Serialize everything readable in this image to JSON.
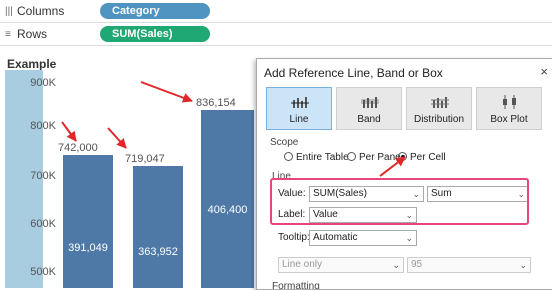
{
  "shelves": {
    "columns": {
      "label": "Columns",
      "pill": "Category"
    },
    "rows": {
      "label": "Rows",
      "pill": "SUM(Sales)"
    }
  },
  "view": {
    "title": "Example",
    "y_ticks": [
      "900K",
      "800K",
      "700K",
      "600K",
      "500K"
    ],
    "bars": [
      {
        "inner": "",
        "label": ""
      },
      {
        "inner": "391,049",
        "label": "742,000"
      },
      {
        "inner": "363,952",
        "label": "719,047"
      },
      {
        "inner": "406,400",
        "label": "836,154"
      }
    ]
  },
  "dialog": {
    "title": "Add Reference Line, Band or Box",
    "close": "×",
    "types": [
      "Line",
      "Band",
      "Distribution",
      "Box Plot"
    ],
    "scope": {
      "label": "Scope",
      "options": [
        "Entire Table",
        "Per Pane",
        "Per Cell"
      ],
      "selected": "Per Cell"
    },
    "line_section": "Line",
    "value_label": "Value:",
    "value_field": "SUM(Sales)",
    "value_agg": "Sum",
    "label_label": "Label:",
    "label_value": "Value",
    "tooltip_label": "Tooltip:",
    "tooltip_value": "Automatic",
    "line_mode": "Line only",
    "line_pct": "95",
    "formatting": "Formatting"
  },
  "colors": {
    "bar": "#4e79a7",
    "highlight": "#e8457a",
    "arrow": "#e0282a",
    "pill_columns": "#4f94c0",
    "pill_rows": "#1fa873"
  }
}
